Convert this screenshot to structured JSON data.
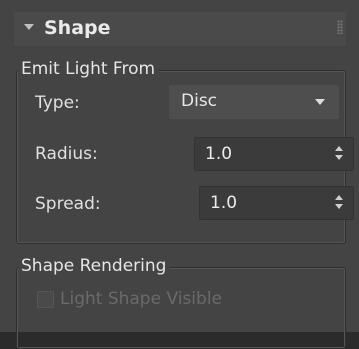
{
  "rollout": {
    "title": "Shape"
  },
  "emit_group": {
    "title": "Emit Light From",
    "type_label": "Type:",
    "type_value": "Disc",
    "radius_label": "Radius:",
    "radius_value": "1.0",
    "spread_label": "Spread:",
    "spread_value": "1.0"
  },
  "render_group": {
    "title": "Shape Rendering",
    "checkbox_label": "Light Shape Visible",
    "checkbox_checked": false,
    "checkbox_enabled": false
  }
}
